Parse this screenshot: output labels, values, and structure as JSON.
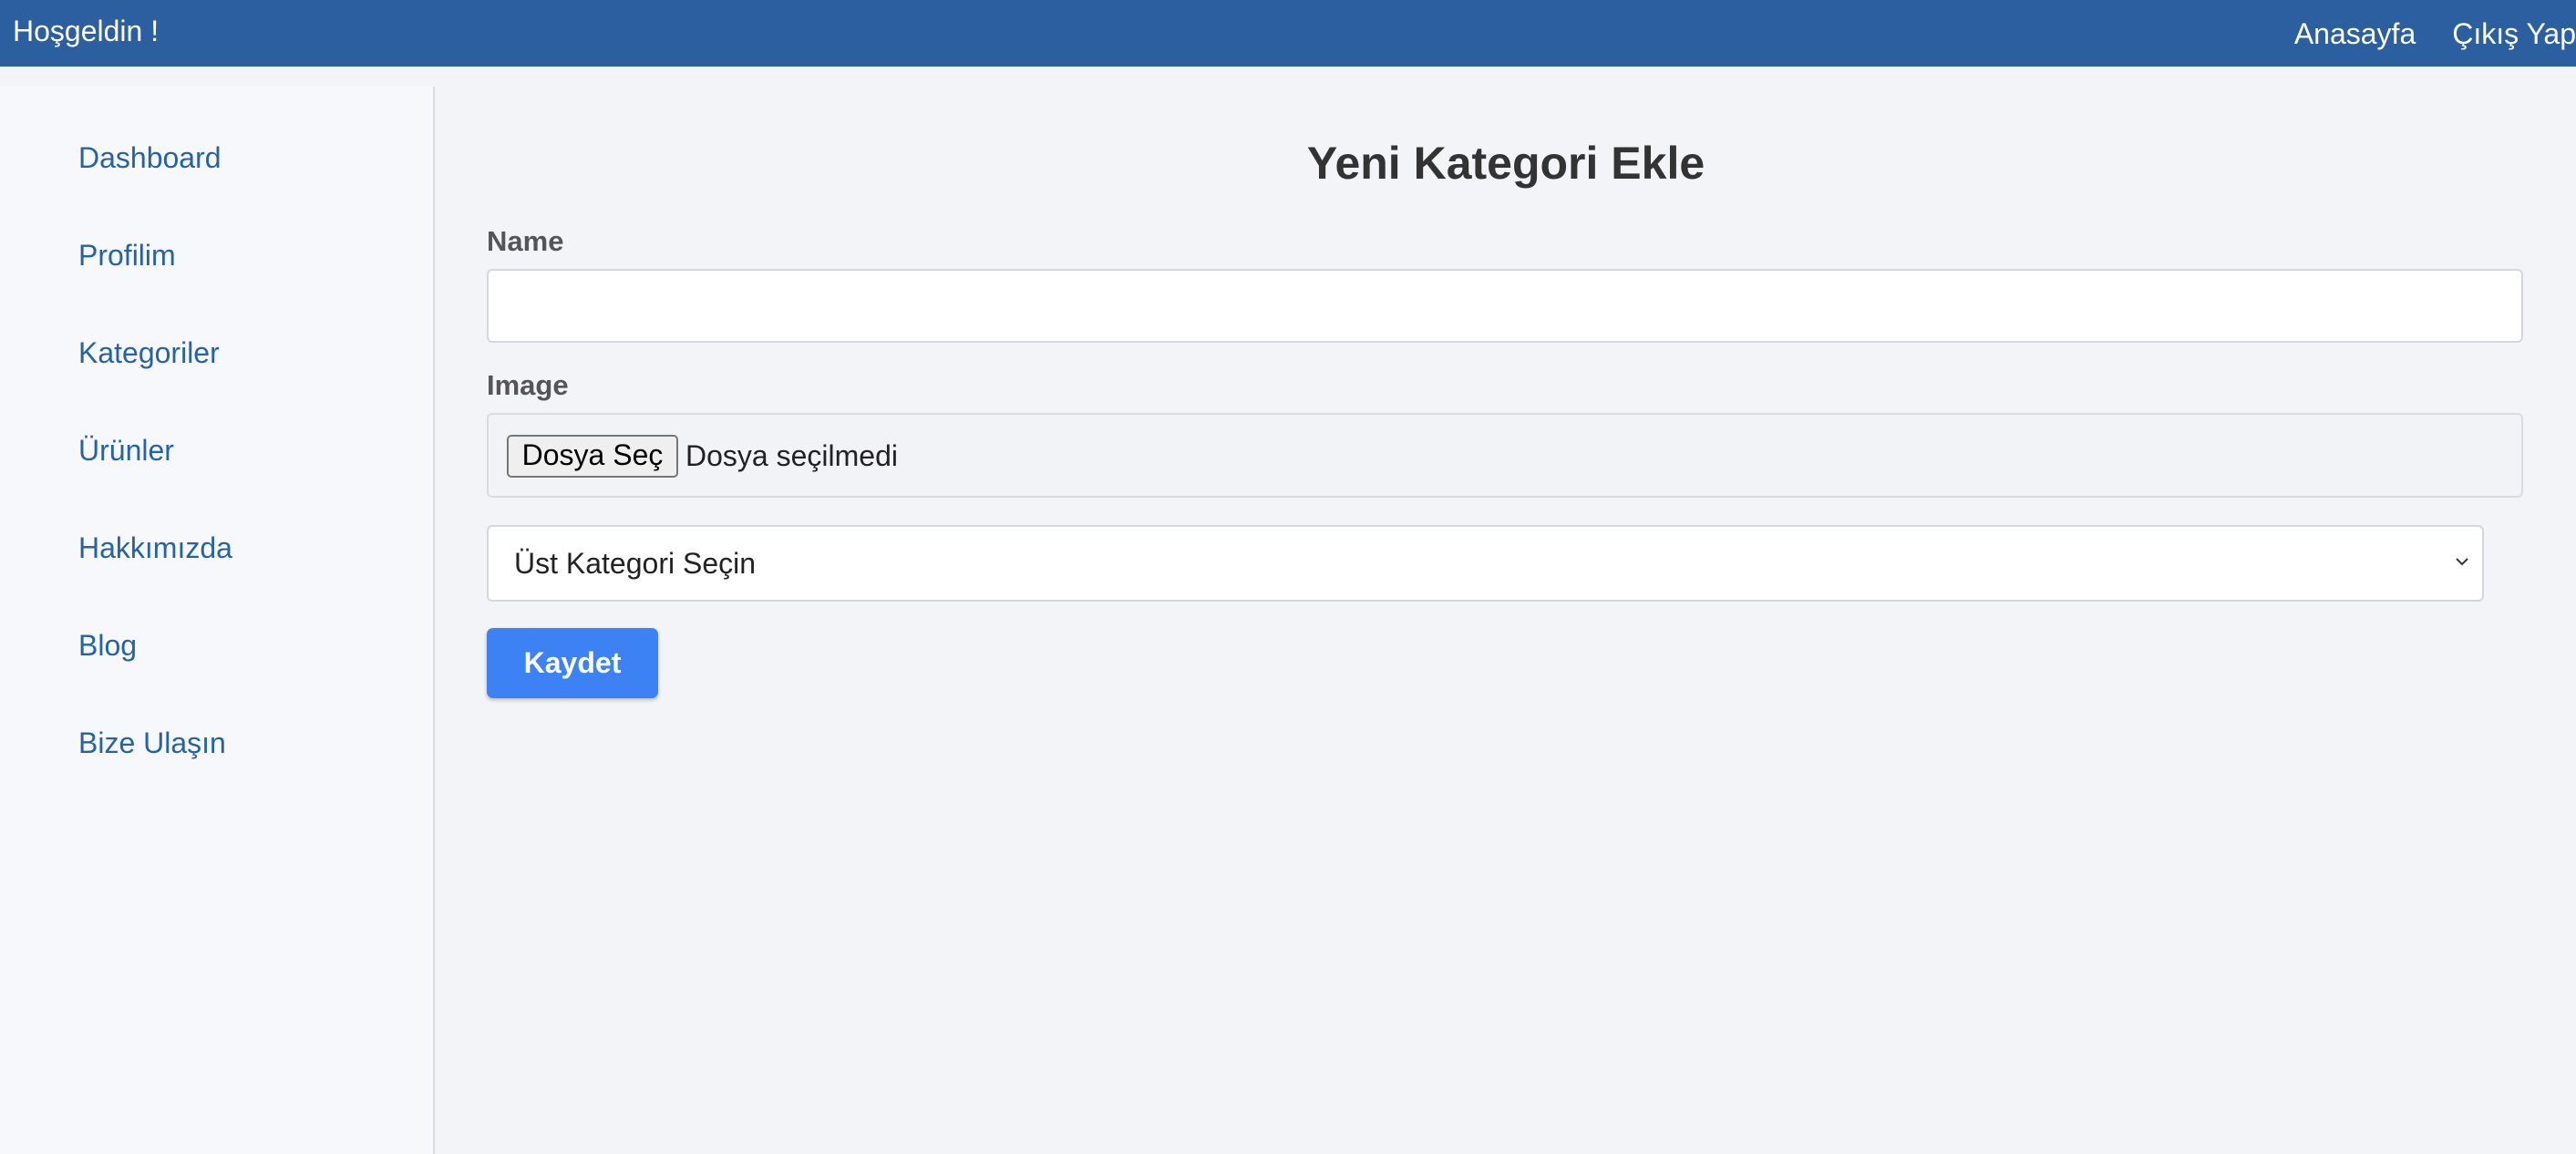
{
  "header": {
    "welcome": "Hoşgeldin !",
    "nav": [
      {
        "label": "Anasayfa"
      },
      {
        "label": "Çıkış Yap"
      }
    ],
    "background_color": "#2b5f9f"
  },
  "sidebar": {
    "items": [
      {
        "label": "Dashboard"
      },
      {
        "label": "Profilim"
      },
      {
        "label": "Kategoriler"
      },
      {
        "label": "Ürünler"
      },
      {
        "label": "Hakkımızda"
      },
      {
        "label": "Blog"
      },
      {
        "label": "Bize Ulaşın"
      }
    ],
    "link_color": "#2563a6"
  },
  "main": {
    "title": "Yeni Kategori Ekle",
    "form": {
      "name_label": "Name",
      "name_value": "",
      "image_label": "Image",
      "file_button": "Dosya Seç",
      "file_status": "Dosya seçilmedi",
      "parent_select": "Üst Kategori Seçin",
      "submit_label": "Kaydet"
    },
    "accent_color": "#3d82f4"
  }
}
